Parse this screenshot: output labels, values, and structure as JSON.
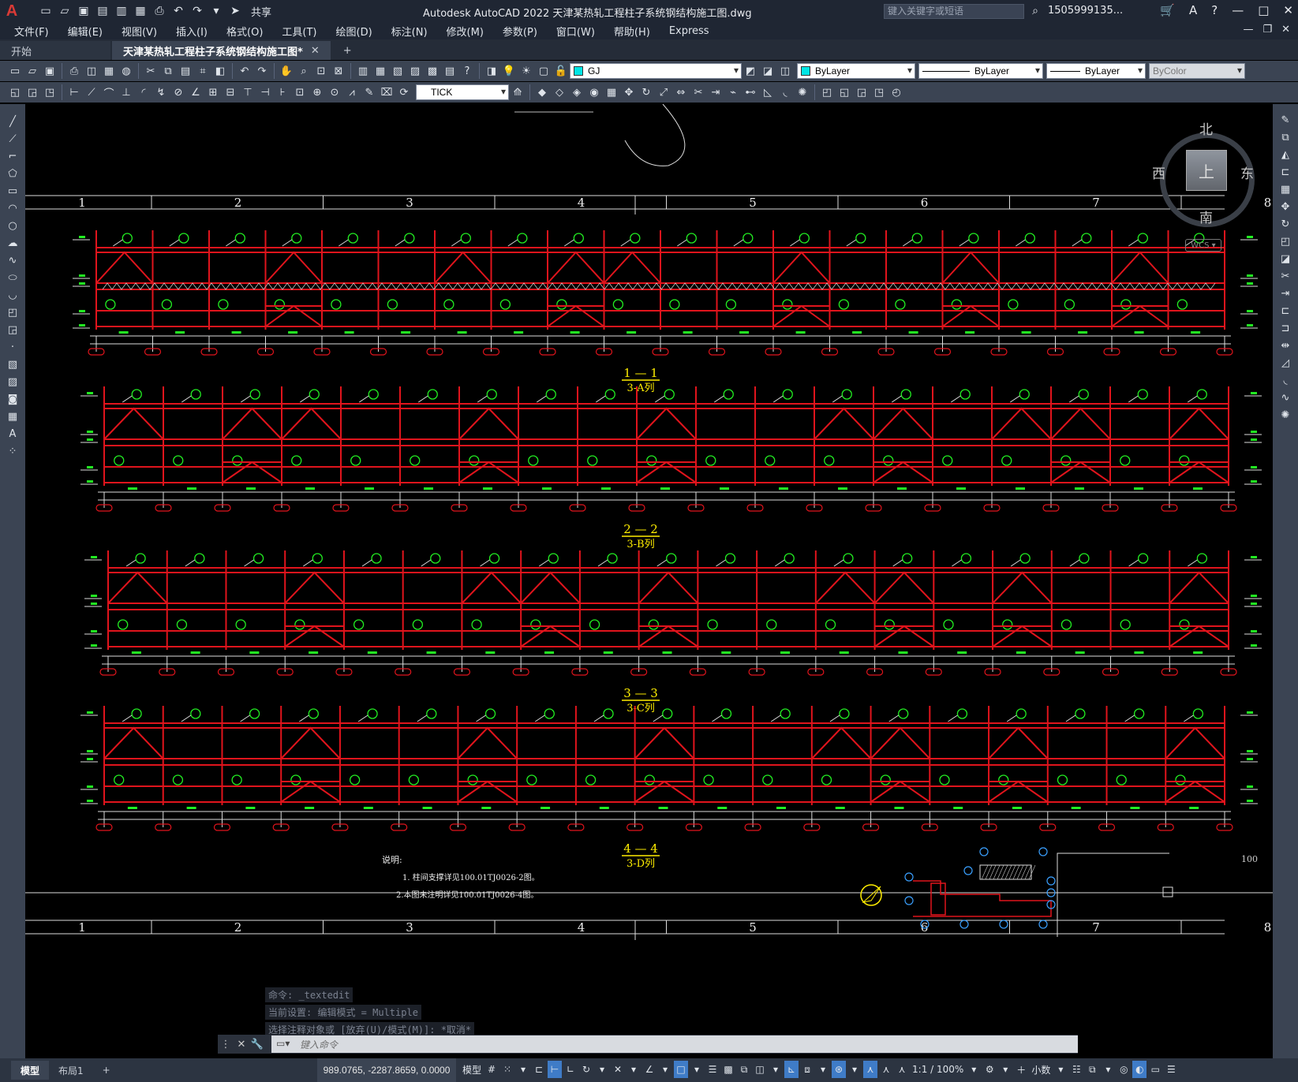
{
  "app": {
    "logo": "A",
    "title": "Autodesk AutoCAD 2022    天津某热轧工程柱子系统钢结构施工图.dwg",
    "share_label": "共享",
    "search_placeholder": "键入关键字或短语",
    "user": "1505999135..."
  },
  "menu": [
    "文件(F)",
    "编辑(E)",
    "视图(V)",
    "插入(I)",
    "格式(O)",
    "工具(T)",
    "绘图(D)",
    "标注(N)",
    "修改(M)",
    "参数(P)",
    "窗口(W)",
    "帮助(H)",
    "Express"
  ],
  "tabs": {
    "start": "开始",
    "active": "天津某热轧工程柱子系统钢结构施工图*"
  },
  "toolbar": {
    "layer": "GJ",
    "color": "ByLayer",
    "linetype": "ByLayer",
    "lineweight": "ByLayer",
    "plotstyle": "ByColor",
    "dimstyle": "TICK",
    "layer_color": "#00e5e5",
    "color_swatch": "#00e5e5"
  },
  "viewcube": {
    "top": "上",
    "north": "北",
    "south": "南",
    "east": "东",
    "west": "西",
    "wcs": "WCS"
  },
  "drawing": {
    "grid_labels": [
      "1",
      "2",
      "3",
      "4",
      "5",
      "6",
      "7",
      "8"
    ],
    "sections": [
      {
        "title": "1 — 1",
        "sub": "3-A列"
      },
      {
        "title": "2 — 2",
        "sub": "3-B列"
      },
      {
        "title": "3 — 3",
        "sub": "3-C列"
      },
      {
        "title": "4 — 4",
        "sub": "3-D列"
      }
    ],
    "notes_title": "说明:",
    "notes": [
      "1. 柱间支撑详见100.01TJ0026-2图。",
      "2.本图未注明详见100.01TJ0026-4图。"
    ],
    "scale_text": "100",
    "structure_color": "#e0141c",
    "bubble_color": "#22ee22",
    "title_color": "#ffee00"
  },
  "command": {
    "history": [
      "命令: _textedit",
      "当前设置: 编辑模式 = Multiple",
      "选择注释对象或 [放弃(U)/模式(M)]: *取消*"
    ],
    "placeholder": "键入命令"
  },
  "status": {
    "layout_tabs": [
      "模型",
      "布局1"
    ],
    "coords": "989.0765, -2287.8659, 0.0000",
    "model": "模型",
    "scale": "1:1 / 100%",
    "units": "小数"
  }
}
